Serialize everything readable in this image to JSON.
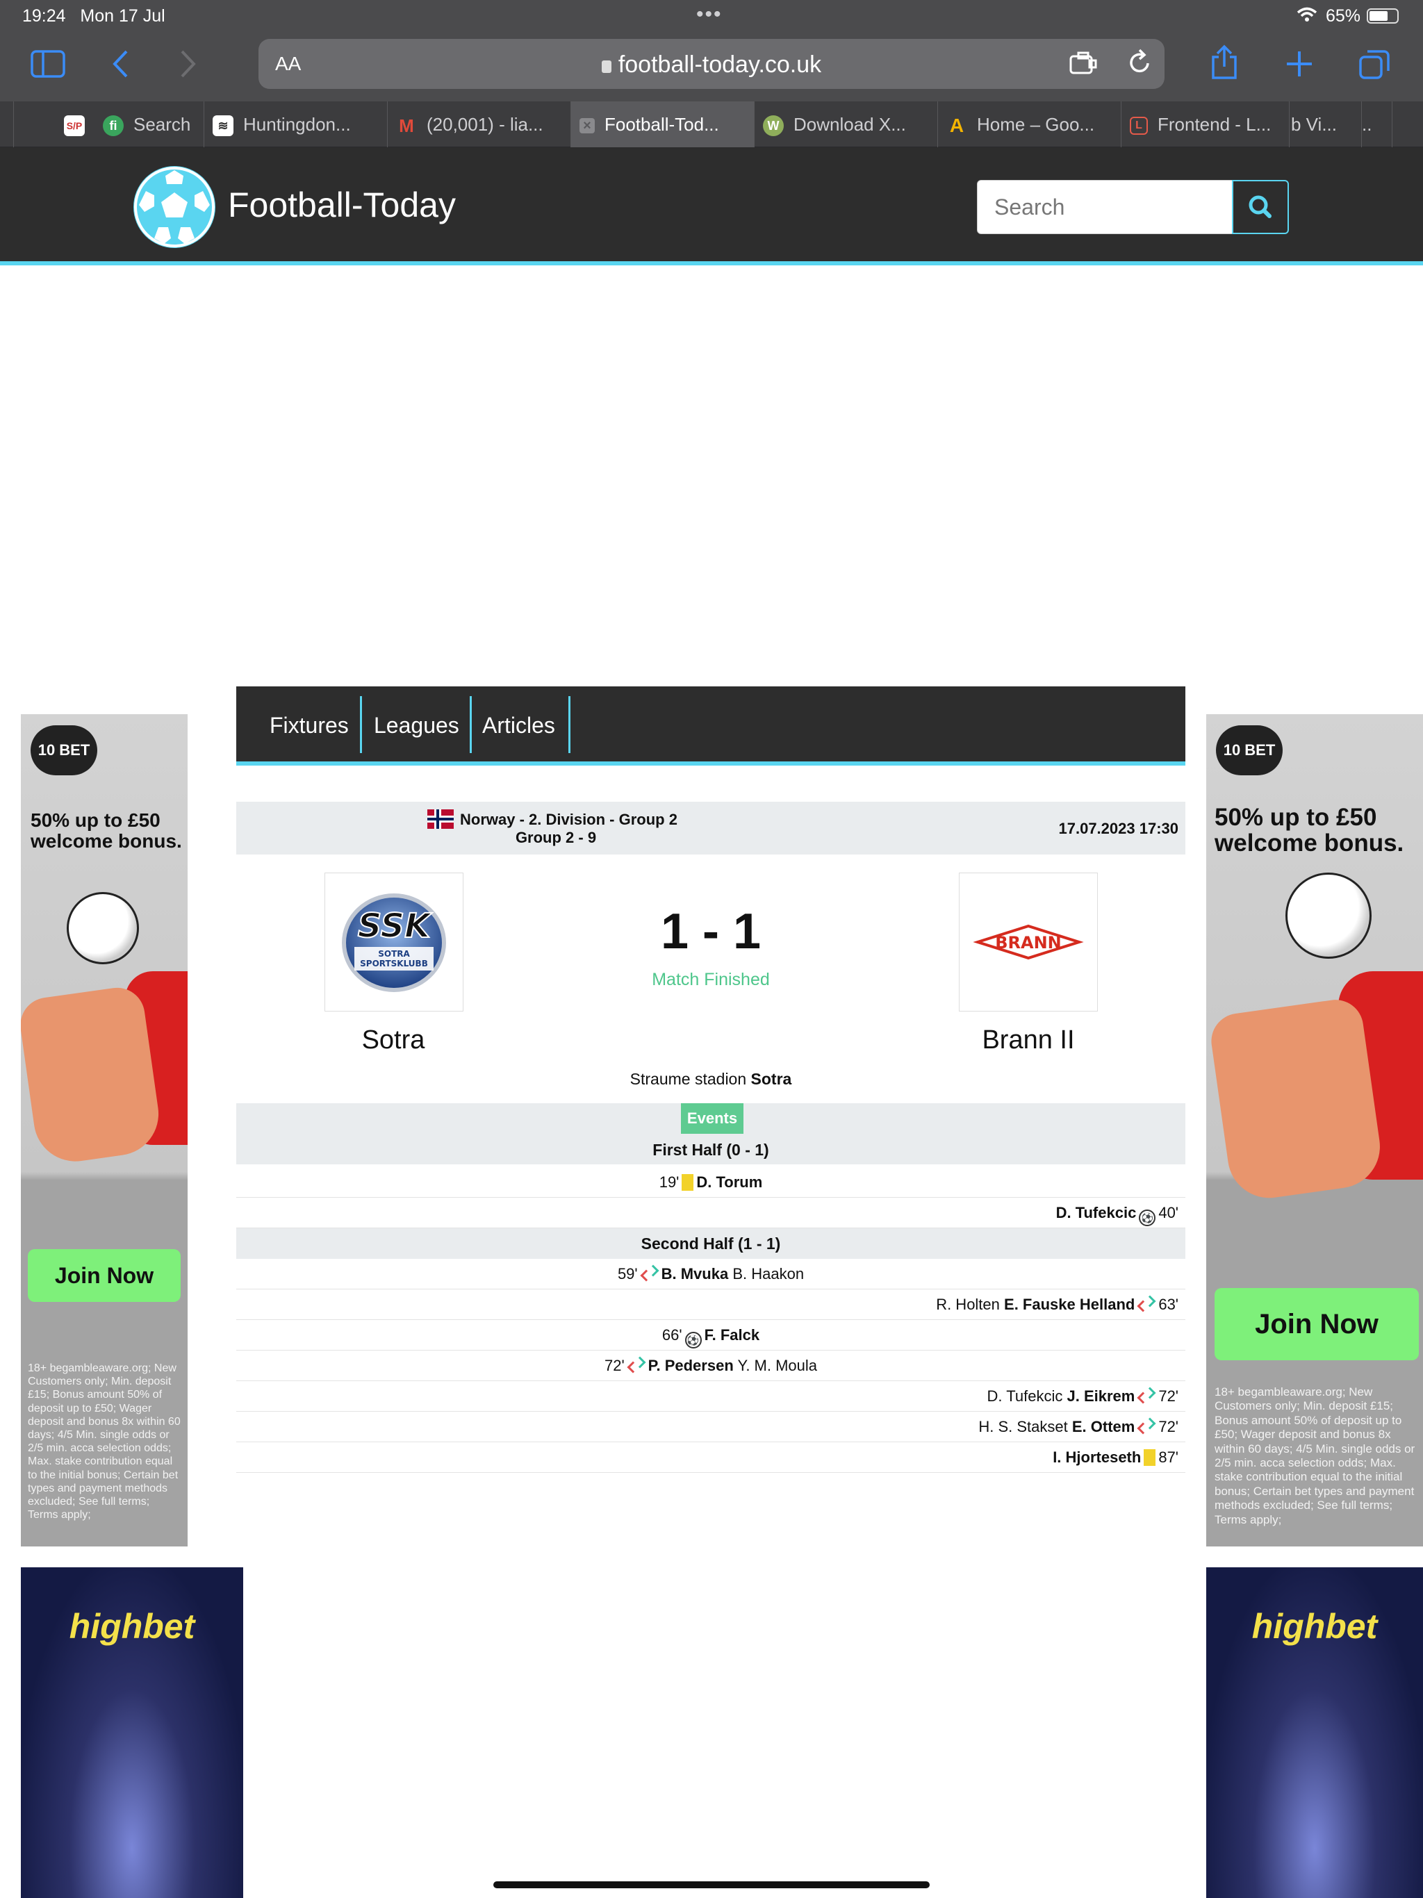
{
  "status_bar": {
    "time": "19:24",
    "date": "Mon 17 Jul",
    "battery": "65%"
  },
  "browser": {
    "text_size_label": "AA",
    "url": "football-today.co.uk",
    "tabs": [
      {
        "label": "",
        "favicon": "S/P",
        "favicon_color": "#ffffff"
      },
      {
        "label": "Search",
        "favicon": "fi",
        "favicon_color": "#3aa55d"
      },
      {
        "label": "Huntingdon...",
        "favicon": "≋",
        "favicon_color": "#ffffff"
      },
      {
        "label": "(20,001) - lia...",
        "favicon": "M",
        "favicon_color": "#ffffff"
      },
      {
        "label": "Football-Tod...",
        "favicon": "×",
        "favicon_color": "#8a8a8d"
      },
      {
        "label": "Download X...",
        "favicon": "W",
        "favicon_color": "#8fae5b"
      },
      {
        "label": "Home – Goo...",
        "favicon": "A",
        "favicon_color": "#f4b400"
      },
      {
        "label": "Frontend - L...",
        "favicon": "L",
        "favicon_color": "#ffffff"
      },
      {
        "label": "b Vi...",
        "favicon": "",
        "favicon_color": ""
      },
      {
        "label": "..",
        "favicon": "",
        "favicon_color": ""
      }
    ]
  },
  "site": {
    "brand": "Football-Today",
    "search_placeholder": "Search",
    "accent_color": "#5ad5f0"
  },
  "nav": {
    "items": [
      "Fixtures",
      "Leagues",
      "Articles"
    ]
  },
  "match": {
    "competition": "Norway - 2. Division - Group 2",
    "round": "Group 2 - 9",
    "datetime": "17.07.2023 17:30",
    "home_team": "Sotra",
    "away_team": "Brann II",
    "home_logo_text": "SOTRA SPORTSKLUBB",
    "away_logo_text": "BRANN",
    "score": "1 - 1",
    "status": "Match Finished",
    "venue_label": "Straume stadion",
    "venue_city": "Sotra"
  },
  "events": {
    "badge": "Events",
    "first_half": "First Half (0 - 1)",
    "second_half": "Second Half (1 - 1)",
    "rows": [
      {
        "minute": "19'",
        "player": "D. Torum",
        "other": ""
      },
      {
        "minute": "40'",
        "player": "D. Tufekcic",
        "other": ""
      },
      {
        "minute": "59'",
        "player": "B. Mvuka",
        "other": "B. Haakon"
      },
      {
        "minute": "63'",
        "player": "E. Fauske Helland",
        "other": "R. Holten"
      },
      {
        "minute": "66'",
        "player": "F. Falck",
        "other": ""
      },
      {
        "minute": "72'",
        "player": "P. Pedersen",
        "other": "Y. M. Moula"
      },
      {
        "minute": "72'",
        "player": "J. Eikrem",
        "other": "D. Tufekcic"
      },
      {
        "minute": "72'",
        "player": "E. Ottem",
        "other": "H. S. Stakset"
      },
      {
        "minute": "87'",
        "player": "I. Hjorteseth",
        "other": ""
      }
    ]
  },
  "ads": {
    "tenbet": {
      "logo": "10 BET",
      "promo": "50% up to £50 welcome bonus.",
      "cta": "Join Now",
      "terms": "18+ begambleaware.org; New Customers only; Min. deposit £15; Bonus amount 50% of deposit up to £50; Wager deposit and bonus 8x within 60 days; 4/5 Min. single odds or 2/5 min. acca selection odds; Max. stake contribution equal to the initial bonus; Certain bet types and payment methods excluded; See full terms; Terms apply;"
    },
    "highbet": {
      "brand": "highbet"
    }
  }
}
